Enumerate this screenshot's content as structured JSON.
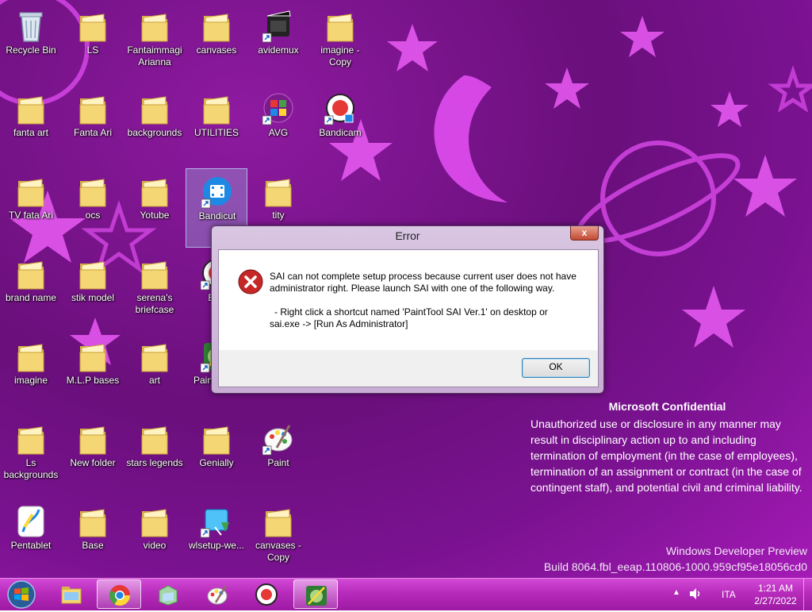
{
  "desktop": {
    "icons": [
      {
        "label": "Recycle Bin",
        "icon": "recycle-bin-icon"
      },
      {
        "label": "LS",
        "icon": "folder-icon"
      },
      {
        "label": "Fantaimmagi Arianna",
        "icon": "folder-icon"
      },
      {
        "label": "canvases",
        "icon": "folder-icon"
      },
      {
        "label": "avidemux",
        "icon": "avidemux-icon"
      },
      {
        "label": "imagine - Copy",
        "icon": "folder-icon"
      },
      {
        "label": "fanta art",
        "icon": "folder-icon"
      },
      {
        "label": "Fanta Ari",
        "icon": "folder-icon"
      },
      {
        "label": "backgrounds",
        "icon": "folder-icon"
      },
      {
        "label": "UTILITIES",
        "icon": "folder-icon"
      },
      {
        "label": "AVG",
        "icon": "avg-icon"
      },
      {
        "label": "Bandicam",
        "icon": "bandicam-icon"
      },
      {
        "label": "TV fata Ari",
        "icon": "folder-icon"
      },
      {
        "label": "ocs",
        "icon": "folder-icon"
      },
      {
        "label": "Yotube",
        "icon": "folder-icon"
      },
      {
        "label": "Bandicut",
        "icon": "bandicut-icon"
      },
      {
        "label": "tity",
        "icon": "folder-icon"
      },
      {
        "label": "brand name",
        "icon": "folder-icon"
      },
      {
        "label": "stik model",
        "icon": "folder-icon"
      },
      {
        "label": "serena's briefcase",
        "icon": "folder-icon"
      },
      {
        "label": "Ban",
        "icon": "bandicam-icon"
      },
      {
        "label": "imagine",
        "icon": "folder-icon"
      },
      {
        "label": "M.L.P bases",
        "icon": "folder-icon"
      },
      {
        "label": "art",
        "icon": "folder-icon"
      },
      {
        "label": "Paint Ver.1",
        "icon": "painttool-sai-icon"
      },
      {
        "label": "Ls backgrounds",
        "icon": "folder-icon"
      },
      {
        "label": "New folder",
        "icon": "folder-icon"
      },
      {
        "label": "stars legends",
        "icon": "folder-icon"
      },
      {
        "label": "Genially",
        "icon": "folder-icon"
      },
      {
        "label": "Paint",
        "icon": "paint-icon"
      },
      {
        "label": "Pentablet",
        "icon": "pentablet-icon"
      },
      {
        "label": "Base",
        "icon": "folder-icon"
      },
      {
        "label": "video",
        "icon": "folder-icon"
      },
      {
        "label": "wlsetup-we...",
        "icon": "wlsetup-icon"
      },
      {
        "label": "canvases - Copy",
        "icon": "folder-icon"
      }
    ]
  },
  "dialog": {
    "title": "Error",
    "close_label": "x",
    "message_line1": "SAI can not complete setup process because current user does not have",
    "message_line2": "administrator right. Please launch SAI with one of the following way.",
    "message_line3": "- Right click a shortcut named 'PaintTool SAI Ver.1' on desktop or",
    "message_line4": "sai.exe -> [Run As Administrator]",
    "ok_label": "OK"
  },
  "watermark": {
    "title": "Microsoft Confidential",
    "body": "Unauthorized use or disclosure in any manner may result in disciplinary action up to and including termination of employment (in the case of employees), termination of an assignment or contract (in the case of contingent staff), and potential civil and criminal liability.",
    "edition": "Windows Developer Preview",
    "build": "Build 8064.fbl_eeap.110806-1000.959cf95e18056cd0"
  },
  "taskbar": {
    "pinned": [
      {
        "name": "explorer",
        "icon": "file-explorer-icon"
      },
      {
        "name": "chrome",
        "icon": "chrome-icon"
      },
      {
        "name": "unknown-app",
        "icon": "app-icon"
      },
      {
        "name": "paint",
        "icon": "paint-icon"
      },
      {
        "name": "bandicam",
        "icon": "bandicam-icon"
      },
      {
        "name": "painttool-sai",
        "icon": "painttool-sai-icon"
      }
    ],
    "tray": {
      "language": "ITA",
      "time": "1:21 AM",
      "date": "2/27/2022"
    }
  },
  "colors": {
    "taskbar": "#b72bbb",
    "wallpaper": "#6a0f7c",
    "accent": "#e04ef0"
  }
}
